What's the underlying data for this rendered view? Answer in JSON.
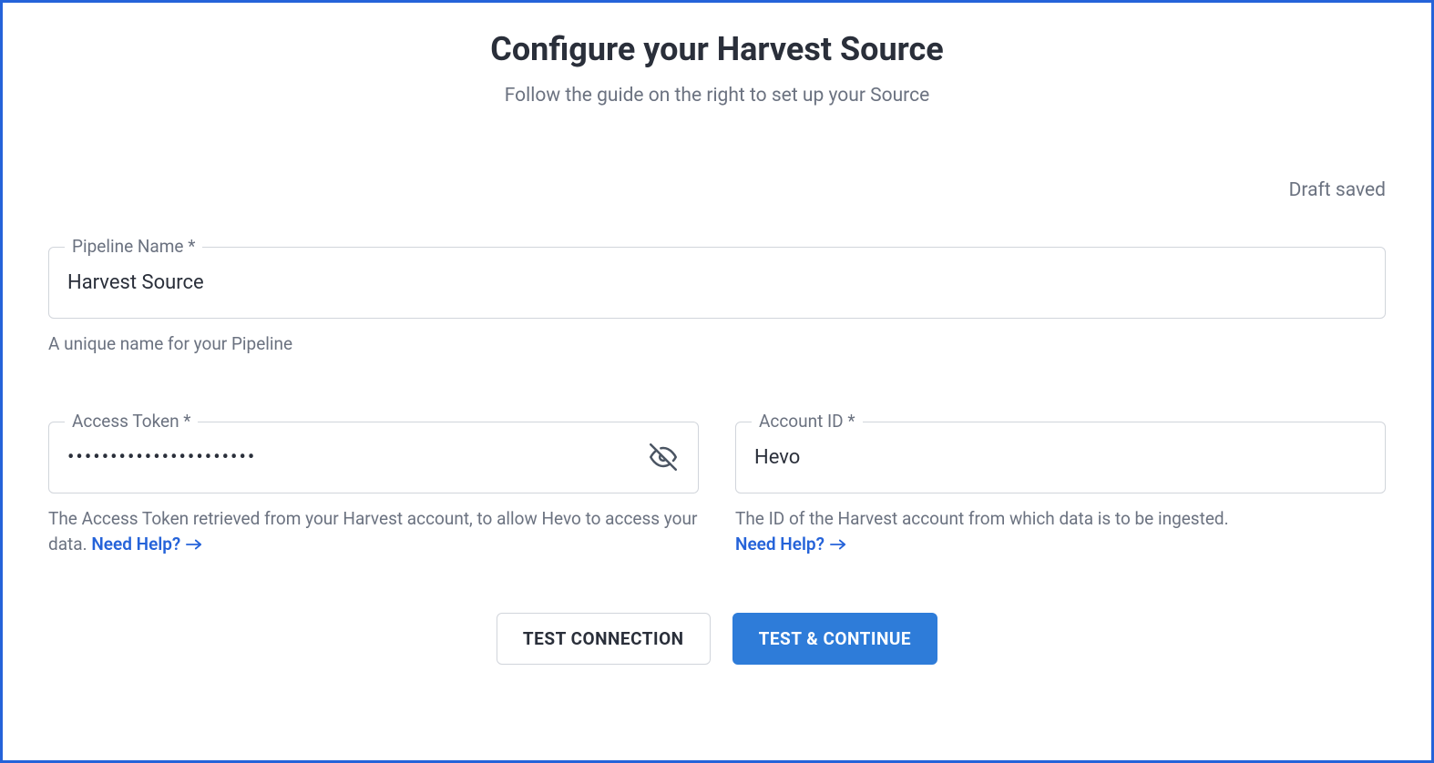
{
  "header": {
    "title": "Configure your Harvest Source",
    "subtitle": "Follow the guide on the right to set up your Source"
  },
  "status": {
    "draft_saved": "Draft saved"
  },
  "fields": {
    "pipeline_name": {
      "label": "Pipeline Name *",
      "value": "Harvest Source",
      "help": "A unique name for your Pipeline"
    },
    "access_token": {
      "label": "Access Token *",
      "value": "••••••••••••••••••••••",
      "help_text": "The Access Token retrieved from your Harvest account, to allow Hevo to access your data. ",
      "help_link": "Need Help?"
    },
    "account_id": {
      "label": "Account ID  *",
      "value": "Hevo",
      "help_text": "The ID of the Harvest account from which data is to be ingested. ",
      "help_link": "Need Help?"
    }
  },
  "buttons": {
    "test_connection": "TEST CONNECTION",
    "test_continue": "TEST & CONTINUE"
  }
}
